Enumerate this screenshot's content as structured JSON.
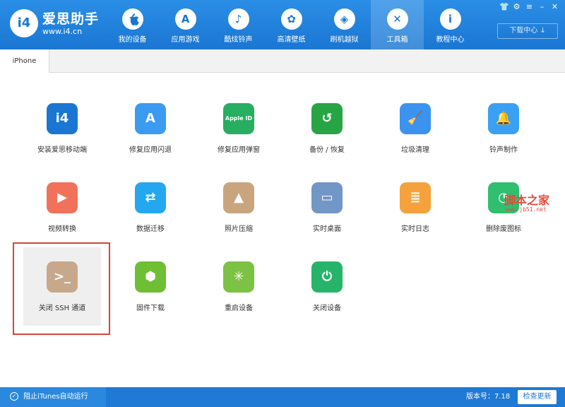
{
  "brand": {
    "name": "爱思助手",
    "url": "www.i4.cn",
    "logo_text": "i4"
  },
  "nav": [
    {
      "label": "我的设备",
      "icon": "apple-icon",
      "glyph": ""
    },
    {
      "label": "应用游戏",
      "icon": "appstore-icon",
      "glyph": "A"
    },
    {
      "label": "酷炫铃声",
      "icon": "bell-icon",
      "glyph": "♪"
    },
    {
      "label": "高清壁纸",
      "icon": "flower-icon",
      "glyph": "✿"
    },
    {
      "label": "刷机越狱",
      "icon": "dropbox-icon",
      "glyph": "◈"
    },
    {
      "label": "工具箱",
      "icon": "tools-icon",
      "glyph": "✕"
    },
    {
      "label": "教程中心",
      "icon": "info-icon",
      "glyph": "i"
    }
  ],
  "window_controls": [
    "shirt-icon",
    "gear-icon",
    "menu-icon",
    "minimize-icon",
    "close-icon"
  ],
  "window_glyphs": [
    "👕",
    "⚙",
    "≡",
    "–",
    "✕"
  ],
  "download_center": "下载中心 ↓",
  "tab": "iPhone",
  "tools": [
    {
      "label": "安装爱思移动端",
      "icon": "i4-mobile-icon",
      "color": "#1a76d2",
      "glyph": "i4"
    },
    {
      "label": "修复应用闪退",
      "icon": "appstore-repair-icon",
      "color": "#3b9bf0",
      "glyph": "A"
    },
    {
      "label": "修复应用弹窗",
      "icon": "appleid-icon",
      "color": "#27ae60",
      "glyph": "Apple ID"
    },
    {
      "label": "备份 / 恢复",
      "icon": "backup-restore-icon",
      "color": "#27a545",
      "glyph": "↺"
    },
    {
      "label": "垃圾清理",
      "icon": "broom-icon",
      "color": "#3b93ef",
      "glyph": "🧹"
    },
    {
      "label": "铃声制作",
      "icon": "bell-icon",
      "color": "#3aa0f3",
      "glyph": "🔔"
    },
    {
      "label": "视频转换",
      "icon": "video-icon",
      "color": "#f2715a",
      "glyph": "▶"
    },
    {
      "label": "数据迁移",
      "icon": "data-transfer-icon",
      "color": "#24a7ee",
      "glyph": "⇄"
    },
    {
      "label": "照片压缩",
      "icon": "photo-icon",
      "color": "#c9a57e",
      "glyph": "▲"
    },
    {
      "label": "实时桌面",
      "icon": "monitor-icon",
      "color": "#7296c5",
      "glyph": "▭"
    },
    {
      "label": "实时日志",
      "icon": "log-icon",
      "color": "#f5a23c",
      "glyph": "≣"
    },
    {
      "label": "删除废图标",
      "icon": "delete-icon",
      "color": "#2fbf6f",
      "glyph": "◔"
    },
    {
      "label": "关闭 SSH 通道",
      "icon": "ssh-terminal-icon",
      "color": "#c7a88a",
      "glyph": ">_"
    },
    {
      "label": "固件下载",
      "icon": "firmware-box-icon",
      "color": "#6fbf35",
      "glyph": "⬢"
    },
    {
      "label": "重启设备",
      "icon": "restart-icon",
      "color": "#7cc244",
      "glyph": "✳"
    },
    {
      "label": "关闭设备",
      "icon": "power-icon",
      "color": "#27b46a",
      "glyph": "⏻"
    }
  ],
  "watermark": {
    "title": "脚本之家",
    "url": "www.jb51.net"
  },
  "statusbar": {
    "itunes_label": "阻止iTunes自动运行",
    "version": "版本号：7.18",
    "update_button": "检查更新"
  }
}
